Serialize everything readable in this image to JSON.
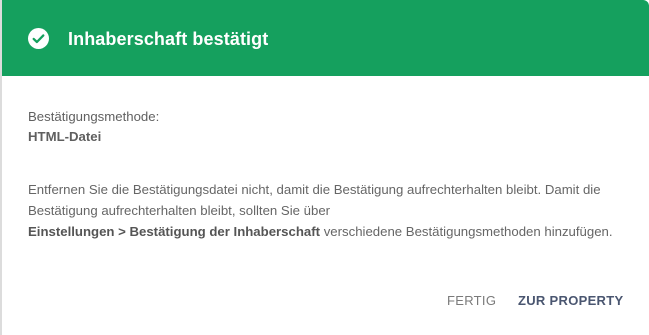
{
  "header": {
    "title": "Inhaberschaft bestätigt",
    "background_color": "#15a05e",
    "icon": "check-circle-icon"
  },
  "method": {
    "label": "Bestätigungsmethode:",
    "value": "HTML-Datei"
  },
  "description": {
    "text_part1": "Entfernen Sie die Bestätigungsdatei nicht, damit die Bestätigung aufrechterhalten bleibt. Damit die Bestätigung aufrechterhalten bleibt, sollten Sie über",
    "link_text": "Einstellungen > Bestätigung der Inhaberschaft",
    "text_part2": "verschiedene Bestätigungsmethoden hinzufügen."
  },
  "actions": {
    "done_label": "FERTIG",
    "go_label": "ZUR PROPERTY"
  }
}
